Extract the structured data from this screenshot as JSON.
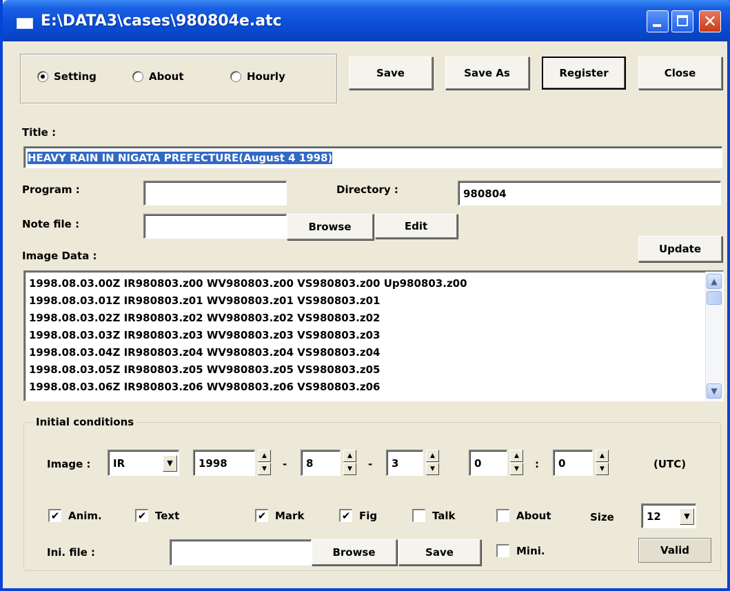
{
  "window": {
    "title": "E:\\DATA3\\cases\\980804e.atc",
    "accent": "#0842D6",
    "background": "#ECE9D8"
  },
  "mode": {
    "options": [
      "Setting",
      "About",
      "Hourly"
    ],
    "selected": "Setting"
  },
  "toolbar": {
    "save": "Save",
    "save_as": "Save As",
    "register": "Register",
    "close": "Close"
  },
  "title_section": {
    "label": "Title :",
    "value": "HEAVY RAIN IN NIGATA PREFECTURE(August 4 1998)"
  },
  "program": {
    "label": "Program :",
    "value": ""
  },
  "directory": {
    "label": "Directory :",
    "value": "980804"
  },
  "note_file": {
    "label": "Note file :",
    "value": "",
    "browse": "Browse",
    "edit": "Edit"
  },
  "image_data": {
    "label": "Image Data :",
    "update": "Update",
    "lines": [
      "1998.08.03.00Z IR980803.z00 WV980803.z00 VS980803.z00 Up980803.z00",
      "1998.08.03.01Z IR980803.z01 WV980803.z01 VS980803.z01",
      "1998.08.03.02Z IR980803.z02 WV980803.z02 VS980803.z02",
      "1998.08.03.03Z IR980803.z03 WV980803.z03 VS980803.z03",
      "1998.08.03.04Z IR980803.z04 WV980803.z04 VS980803.z04",
      "1998.08.03.05Z IR980803.z05 WV980803.z05 VS980803.z05",
      "1998.08.03.06Z IR980803.z06 WV980803.z06 VS980803.z06"
    ]
  },
  "initial_conditions": {
    "title": "Initial conditions",
    "image_label": "Image :",
    "image_type": "IR",
    "year": "1998",
    "month": "8",
    "day": "3",
    "hour": "0",
    "minute": "0",
    "dash": "-",
    "colon": ":",
    "utc": "(UTC)",
    "checks": {
      "anim": {
        "label": "Anim.",
        "checked": true
      },
      "text": {
        "label": "Text",
        "checked": true
      },
      "mark": {
        "label": "Mark",
        "checked": true
      },
      "fig": {
        "label": "Fig",
        "checked": true
      },
      "talk": {
        "label": "Talk",
        "checked": false
      },
      "about": {
        "label": "About",
        "checked": false
      },
      "mini": {
        "label": "Mini.",
        "checked": false
      }
    },
    "size_label": "Size",
    "size_value": "12",
    "ini_file_label": "Ini. file :",
    "ini_file_value": "",
    "browse": "Browse",
    "save": "Save",
    "valid": "Valid"
  },
  "glyphs": {
    "check": "✔",
    "up": "▲",
    "down": "▼",
    "close": "✕"
  }
}
